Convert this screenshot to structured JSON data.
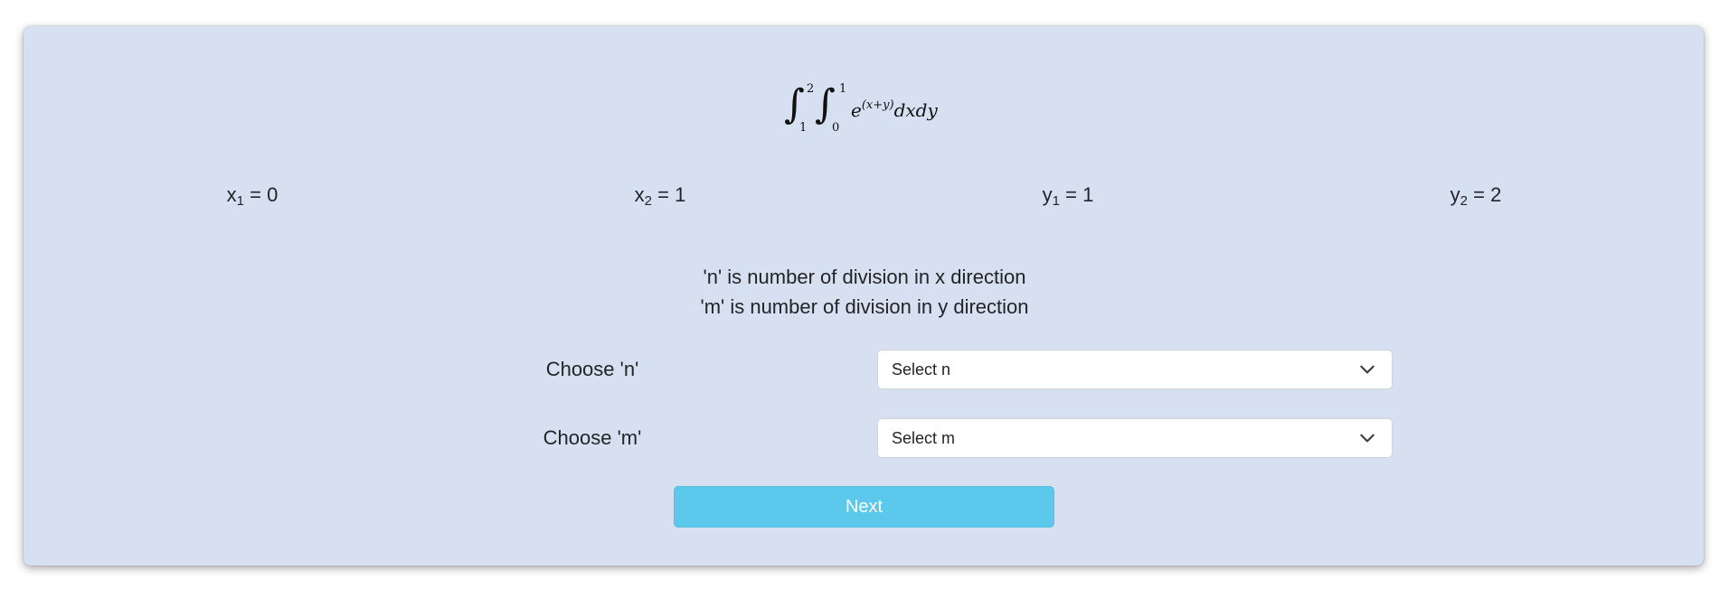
{
  "formula": {
    "outer_upper": "2",
    "outer_lower": "1",
    "inner_upper": "1",
    "inner_lower": "0",
    "integrand_base": "e",
    "integrand_exponent": "(x+y)",
    "differentials": "dxdy"
  },
  "bounds": [
    {
      "var": "x",
      "sub": "1",
      "value": "= 0"
    },
    {
      "var": "x",
      "sub": "2",
      "value": "= 1"
    },
    {
      "var": "y",
      "sub": "1",
      "value": "= 1"
    },
    {
      "var": "y",
      "sub": "2",
      "value": "= 2"
    }
  ],
  "info": {
    "line1": "'n' is number of division in x direction",
    "line2": "'m' is number of division in y direction"
  },
  "form": {
    "n_label": "Choose 'n'",
    "n_placeholder": "Select n",
    "m_label": "Choose 'm'",
    "m_placeholder": "Select m"
  },
  "next_label": "Next",
  "colors": {
    "card_background": "#d6e0f0",
    "button": "#5bc8ec"
  }
}
